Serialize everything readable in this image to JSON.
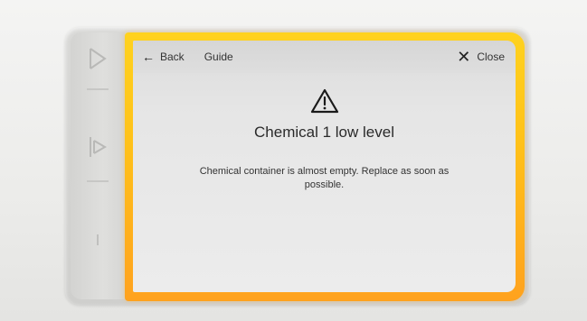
{
  "topbar": {
    "back_label": "Back",
    "guide_label": "Guide",
    "close_label": "Close"
  },
  "alert": {
    "icon": "warning-triangle-icon",
    "title": "Chemical 1 low level",
    "message": "Chemical container is almost empty. Replace as soon as possible."
  },
  "colors": {
    "screen_border_top": "#ffd21e",
    "screen_border_bottom": "#ffa21e"
  }
}
